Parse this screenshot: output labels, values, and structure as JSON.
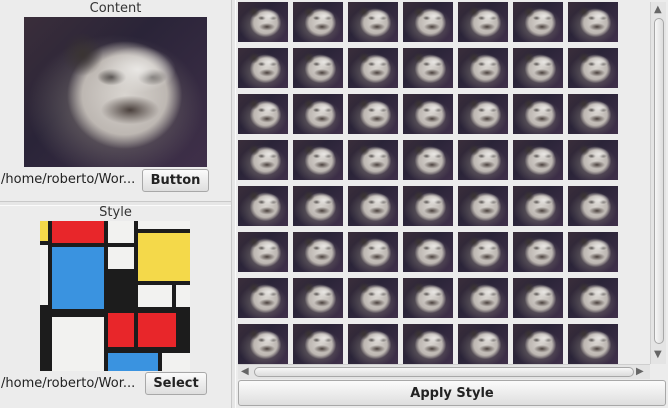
{
  "content_panel": {
    "title": "Content",
    "path": "/home/roberto/Wor...",
    "button_label": "Button"
  },
  "style_panel": {
    "title": "Style",
    "path": "/home/roberto/Wor...",
    "button_label": "Select"
  },
  "output_panel": {
    "columns": 7,
    "tiles_visible": 56,
    "apply_label": "Apply Style"
  },
  "icons": {
    "scroll_up": "scroll-up-arrow-icon",
    "scroll_down": "scroll-down-arrow-icon",
    "scroll_left": "scroll-left-arrow-icon",
    "scroll_right": "scroll-right-arrow-icon"
  },
  "colors": {
    "mondrian_red": "#e8262a",
    "mondrian_blue": "#3a93e0",
    "mondrian_yellow": "#f4d94a",
    "mondrian_white": "#f2f2f0"
  }
}
